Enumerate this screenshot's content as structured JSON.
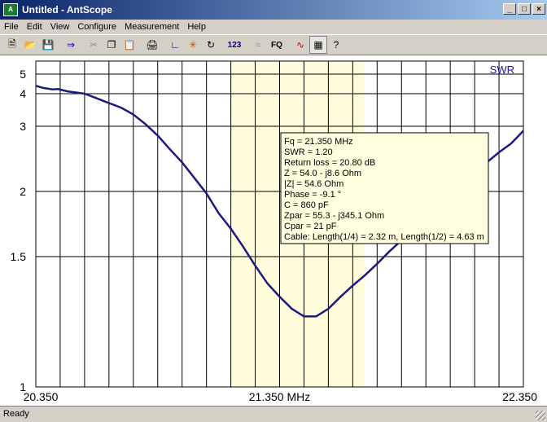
{
  "window": {
    "title": "Untitled - AntScope",
    "icon": "antscope-app-icon"
  },
  "menu": [
    "File",
    "Edit",
    "View",
    "Configure",
    "Measurement",
    "Help"
  ],
  "toolbar": {
    "icons": [
      "new-icon",
      "open-icon",
      "save-icon",
      "export-icon",
      "cut-icon",
      "copy-icon",
      "paste-icon",
      "print-icon",
      "chart-icon",
      "scan-icon",
      "refresh-icon",
      "wifi-icon",
      "markers-icon",
      "memory-icon",
      "help-icon"
    ],
    "label_123": "123",
    "label_fq": "FQ"
  },
  "chart_data": {
    "type": "line",
    "series_label": "SWR",
    "x_range": [
      20.35,
      22.35
    ],
    "y_range": [
      1,
      6
    ],
    "x_ticks": [
      "20.350",
      "21.350 MHz",
      "22.350"
    ],
    "y_ticks": [
      "5",
      "4",
      "3",
      "2",
      "1.5",
      "1"
    ],
    "highlight_band": [
      21.15,
      21.7
    ],
    "line_color": "#1a1a80",
    "x": [
      20.35,
      20.38,
      20.42,
      20.44,
      20.48,
      20.55,
      20.6,
      20.65,
      20.7,
      20.75,
      20.8,
      20.85,
      20.9,
      20.95,
      21.0,
      21.05,
      21.1,
      21.15,
      21.2,
      21.25,
      21.3,
      21.35,
      21.4,
      21.45,
      21.5,
      21.55,
      21.6,
      21.65,
      21.7,
      21.75,
      21.8,
      21.85,
      21.9,
      21.95,
      22.0,
      22.05,
      22.1,
      22.15,
      22.2,
      22.25,
      22.3,
      22.35
    ],
    "y": [
      4.35,
      4.25,
      4.18,
      4.2,
      4.1,
      4.0,
      3.82,
      3.65,
      3.5,
      3.3,
      3.05,
      2.8,
      2.55,
      2.35,
      2.15,
      1.98,
      1.8,
      1.68,
      1.56,
      1.45,
      1.36,
      1.3,
      1.25,
      1.22,
      1.22,
      1.25,
      1.3,
      1.35,
      1.4,
      1.46,
      1.53,
      1.6,
      1.67,
      1.75,
      1.85,
      1.95,
      2.05,
      2.2,
      2.35,
      2.5,
      2.65,
      2.9
    ]
  },
  "marker_info": {
    "lines": [
      "Fq = 21.350 MHz",
      "SWR = 1.20",
      "Return loss = 20.80 dB",
      "Z = 54.0 - j8.6 Ohm",
      "|Z| = 54.6 Ohm",
      "Phase = -9.1 °",
      "C = 860 pF",
      "Zpar = 55.3 - j345.1 Ohm",
      "Cpar = 21 pF",
      "Cable: Length(1/4) = 2.32 m, Length(1/2) = 4.63 m"
    ]
  },
  "status": {
    "text": "Ready"
  }
}
